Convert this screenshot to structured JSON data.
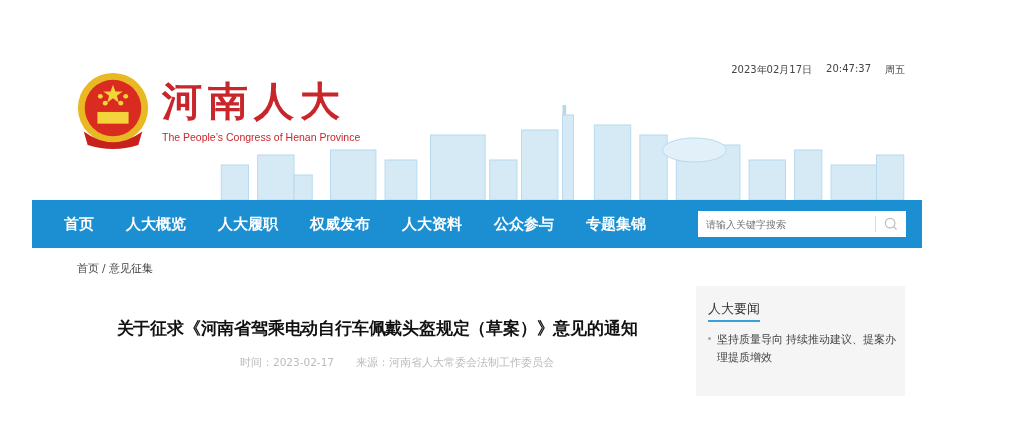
{
  "header": {
    "logo_title": "河南人大",
    "logo_subtitle": "The People’s Congress of Henan Province",
    "date": "2023年02月17日",
    "time": "20:47:37",
    "weekday": "周五"
  },
  "nav": {
    "items": [
      {
        "label": "首页",
        "selected": false
      },
      {
        "label": "人大概览",
        "selected": false
      },
      {
        "label": "人大履职",
        "selected": false
      },
      {
        "label": "权威发布",
        "selected": false
      },
      {
        "label": "人大资料",
        "selected": false
      },
      {
        "label": "公众参与",
        "selected": false
      },
      {
        "label": "专题集锦",
        "selected": false
      }
    ],
    "search": {
      "placeholder": "请输入关键字搜索"
    }
  },
  "breadcrumb": [
    {
      "label": "首页"
    },
    {
      "label": "意见征集"
    }
  ],
  "breadcrumb_separator": "/",
  "article": {
    "title": "关于征求《河南省驾乘电动自行车佩戴头盔规定（草案）》意见的通知",
    "time": "时间：2023-02-17",
    "source": "来源：河南省人大常委会法制工作委员会"
  },
  "sidebar": {
    "title": "人大要闻",
    "items": [
      {
        "text": "坚持质量导向 持续推动建议、提案办理提质增效"
      }
    ]
  }
}
